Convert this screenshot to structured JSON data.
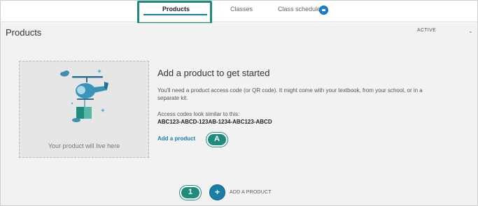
{
  "tabs": {
    "products": "Products",
    "classes": "Classes",
    "class_schedule": "Class schedule"
  },
  "page": {
    "title": "Products",
    "filter_value": "ACTIVE"
  },
  "placeholder": {
    "caption": "Your product will live here"
  },
  "empty_state": {
    "heading": "Add a product to get started",
    "description": "You'll need a product access code (or QR code). It might come with your textbook, from your school, or in a separate kit.",
    "codes_label": "Access codes look similar to this:",
    "codes_example": "ABC123-ABCD-123AB-1234-ABC123-ABCD",
    "add_link": "Add a product"
  },
  "callouts": {
    "a": "A",
    "one": "1"
  },
  "add_button": {
    "symbol": "+",
    "label": "ADD A PRODUCT"
  },
  "icons": {
    "schedule_badge": "message-badge-icon",
    "filter_chevron": "chevron-down-icon",
    "illustration": "helicopter-delivery-illustration",
    "add": "plus-icon"
  },
  "colors": {
    "accent": "#1a7fa6",
    "callout": "#1e8b7c",
    "badge": "#1a7fd4"
  }
}
